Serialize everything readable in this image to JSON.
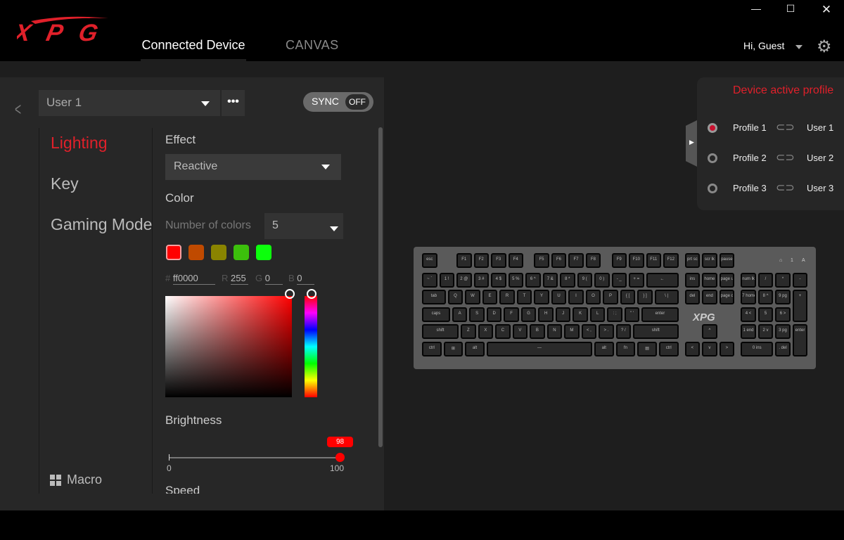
{
  "app": {
    "logo": "XPG",
    "tabs": [
      "Connected Device",
      "CANVAS"
    ],
    "greeting": "Hi, Guest",
    "window_controls": [
      "minimize",
      "maximize",
      "close"
    ]
  },
  "toolbar": {
    "profile_select": "User 1",
    "more_label": "•••",
    "sync_label": "SYNC",
    "sync_state": "OFF"
  },
  "sidebar": {
    "items": [
      "Lighting",
      "Key",
      "Gaming Mode"
    ],
    "active": "Lighting",
    "macro_label": "Macro"
  },
  "lighting": {
    "effect_label": "Effect",
    "effect_value": "Reactive",
    "color_label": "Color",
    "num_colors_label": "Number of colors",
    "num_colors_value": "5",
    "swatches": [
      "#ff0000",
      "#c04a00",
      "#8a8400",
      "#3cc00c",
      "#0cff0c"
    ],
    "selected_swatch": 0,
    "hex_label": "#",
    "hex": "ff0000",
    "r_label": "R",
    "r": "255",
    "g_label": "G",
    "g": "0",
    "b_label": "B",
    "b": "0",
    "brightness_label": "Brightness",
    "brightness": 98,
    "brightness_tip": "98",
    "brightness_min": "0",
    "brightness_max": "100",
    "speed_label": "Speed"
  },
  "profiles": {
    "title": "Device active profile",
    "items": [
      {
        "profile": "Profile 1",
        "user": "User 1",
        "active": true
      },
      {
        "profile": "Profile 2",
        "user": "User 2",
        "active": false
      },
      {
        "profile": "Profile 3",
        "user": "User 3",
        "active": false
      }
    ]
  },
  "colors": {
    "accent": "#e0202a",
    "bg": "#1e1e1e",
    "panel": "#272727"
  },
  "keyboard": {
    "brand": "XPG",
    "indicators": [
      "⌂",
      "1",
      "A"
    ],
    "main": [
      [
        "esc",
        "F1",
        "F2",
        "F3",
        "F4",
        "F5",
        "F6",
        "F7",
        "F8",
        "F9",
        "F10",
        "F11",
        "F12"
      ],
      [
        "~ `",
        "1 !",
        "2 @",
        "3 #",
        "4 $",
        "5 %",
        "6 ^",
        "7 &",
        "8 *",
        "9 (",
        "0 )",
        "- _",
        "+ =",
        "←"
      ],
      [
        "tab",
        "Q",
        "W",
        "E",
        "R",
        "T",
        "Y",
        "U",
        "I",
        "O",
        "P",
        "{ [",
        "} ]",
        "\\ |"
      ],
      [
        "caps",
        "A",
        "S",
        "D",
        "F",
        "G",
        "H",
        "J",
        "K",
        "L",
        ": ;",
        "\" '",
        "enter"
      ],
      [
        "shift",
        "Z",
        "X",
        "C",
        "V",
        "B",
        "N",
        "M",
        "< ,",
        "> .",
        "? /",
        "shift"
      ],
      [
        "ctrl",
        "⊞",
        "alt",
        "—",
        "alt",
        "fn",
        "▤",
        "ctrl"
      ]
    ],
    "nav": [
      [
        "prt sc",
        "scr lk",
        "pause"
      ],
      [
        "ins",
        "home",
        "page up"
      ],
      [
        "del",
        "end",
        "page down"
      ],
      [
        "^"
      ],
      [
        "<",
        "v",
        ">"
      ]
    ],
    "numpad": [
      [
        "num lk",
        "/",
        "*",
        "-"
      ],
      [
        "7 home",
        "8 ^",
        "9 pg",
        "+"
      ],
      [
        "4 <",
        "5",
        "6 >"
      ],
      [
        "1 end",
        "2 v",
        "3 pg",
        "enter"
      ],
      [
        "0 ins",
        ". del"
      ]
    ]
  }
}
